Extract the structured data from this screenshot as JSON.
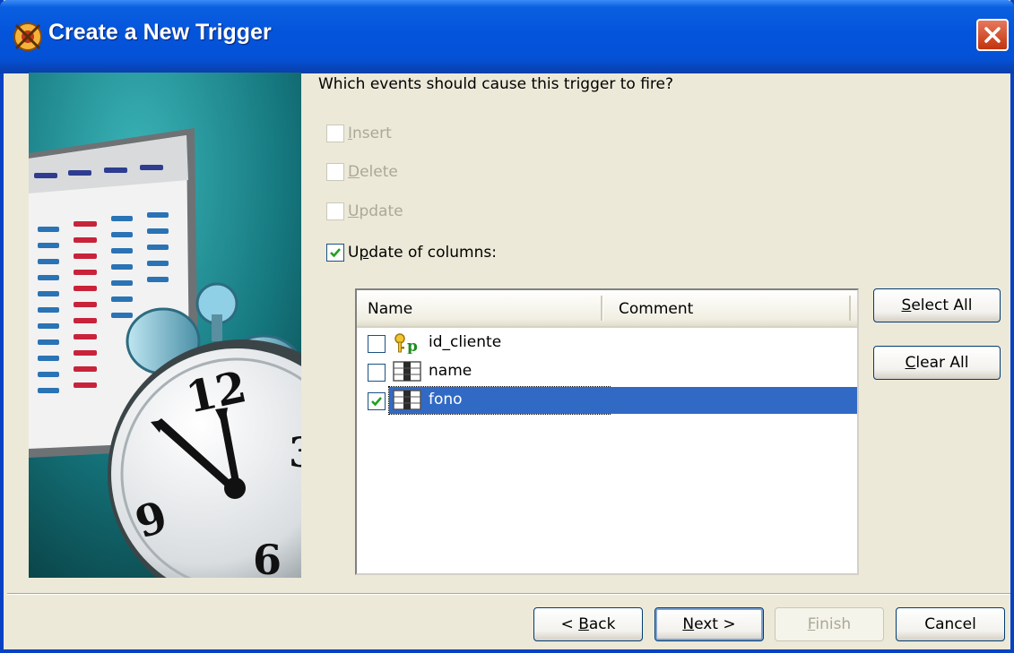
{
  "window": {
    "title": "Create a New Trigger",
    "colors": {
      "title_bar": "#0454DB",
      "face": "#ECE9D8",
      "selection": "#316AC5",
      "check": "#21A121"
    }
  },
  "question": "Which events should cause this trigger to fire?",
  "events": [
    {
      "prefix": "",
      "mnemonic": "I",
      "rest": "nsert",
      "checked": false,
      "enabled": false
    },
    {
      "prefix": "",
      "mnemonic": "D",
      "rest": "elete",
      "checked": false,
      "enabled": false
    },
    {
      "prefix": "",
      "mnemonic": "U",
      "rest": "pdate",
      "checked": false,
      "enabled": false
    },
    {
      "prefix": "U",
      "mnemonic": "p",
      "rest": "date of columns:",
      "checked": true,
      "enabled": true
    }
  ],
  "columns_list": {
    "headers": [
      "Name",
      "Comment"
    ],
    "rows": [
      {
        "name": "id_cliente",
        "comment": "",
        "icon": "primary-key-icon",
        "checked": false,
        "selected": false
      },
      {
        "name": "name",
        "comment": "",
        "icon": "table-column-icon",
        "checked": false,
        "selected": false
      },
      {
        "name": "fono",
        "comment": "",
        "icon": "table-column-icon",
        "checked": true,
        "selected": true
      }
    ]
  },
  "side_buttons": {
    "select_all": {
      "mnemonic": "S",
      "rest": "elect All"
    },
    "clear_all": {
      "mnemonic": "C",
      "rest": "lear All"
    }
  },
  "footer_buttons": {
    "back": {
      "prefix": "< ",
      "mnemonic": "B",
      "rest": "ack"
    },
    "next": {
      "prefix": "",
      "mnemonic": "N",
      "rest": "ext >"
    },
    "finish": {
      "prefix": "",
      "mnemonic": "F",
      "rest": "inish"
    },
    "cancel": {
      "label": "Cancel"
    }
  },
  "icons": {
    "app": "trigger-app-icon",
    "close": "close-icon",
    "illustration": "alarm-clock-calendar-illustration"
  }
}
